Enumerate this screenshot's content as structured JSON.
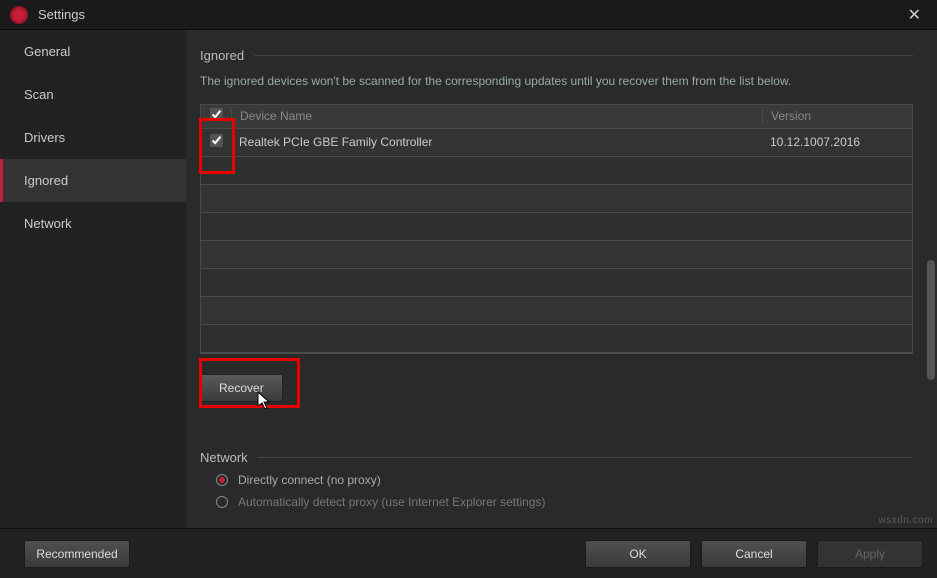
{
  "titlebar": {
    "title": "Settings",
    "close": "✕"
  },
  "sidebar": {
    "items": [
      {
        "label": "General"
      },
      {
        "label": "Scan"
      },
      {
        "label": "Drivers"
      },
      {
        "label": "Ignored"
      },
      {
        "label": "Network"
      }
    ]
  },
  "ignored": {
    "heading": "Ignored",
    "description": "The ignored devices won't be scanned for the corresponding updates until you recover them from the list below.",
    "columns": {
      "name": "Device Name",
      "version": "Version"
    },
    "rows": [
      {
        "name": "Realtek PCIe GBE Family Controller",
        "version": "10.12.1007.2016"
      }
    ],
    "recover_label": "Recover"
  },
  "network": {
    "heading": "Network",
    "options": [
      {
        "label": "Directly connect (no proxy)",
        "selected": true
      },
      {
        "label": "Automatically detect proxy (use Internet Explorer settings)",
        "selected": false
      }
    ]
  },
  "footer": {
    "recommended": "Recommended",
    "ok": "OK",
    "cancel": "Cancel",
    "apply": "Apply"
  },
  "watermark": "wsxdn.com"
}
